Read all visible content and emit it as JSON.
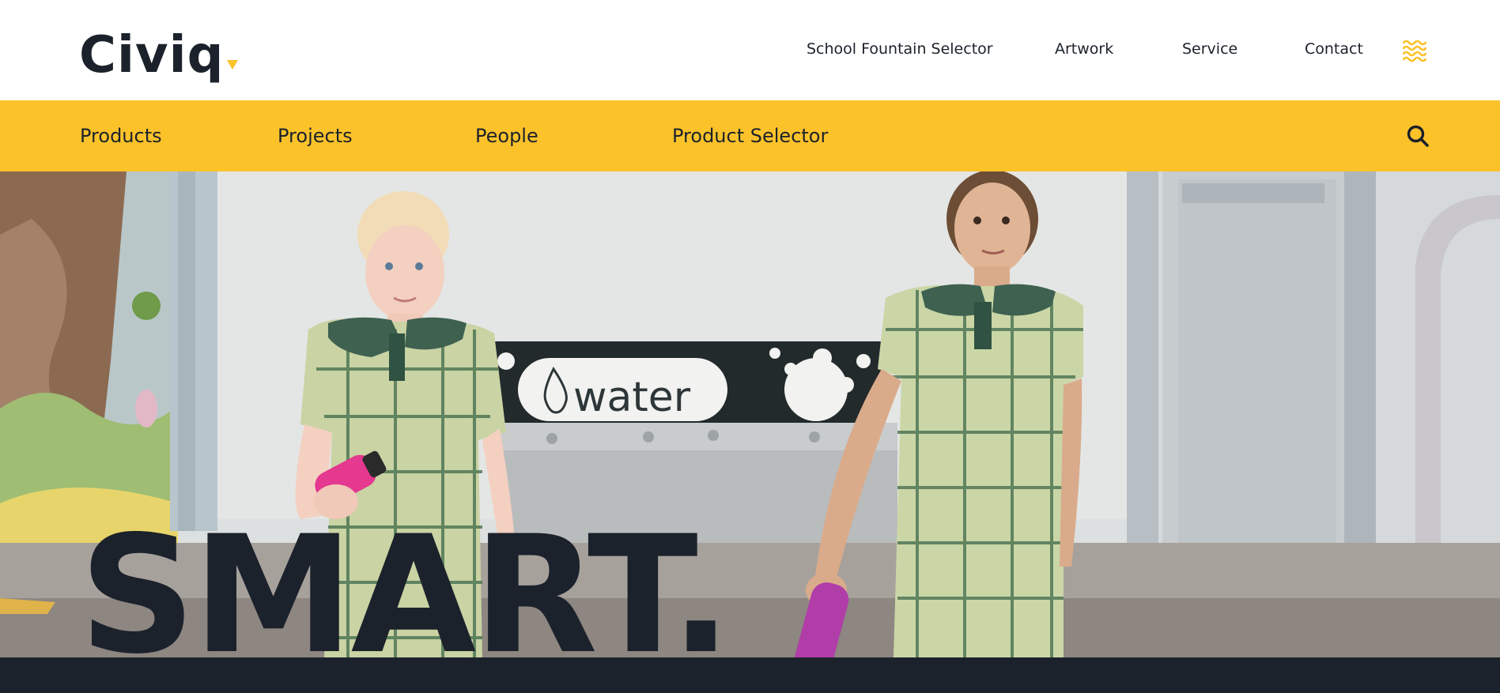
{
  "brand": {
    "name": "Civiq",
    "accent_color": "#fcc22a",
    "dark_color": "#1c222b"
  },
  "utility_nav": {
    "items": [
      {
        "label": "School Fountain Selector"
      },
      {
        "label": "Artwork"
      },
      {
        "label": "Service"
      },
      {
        "label": "Contact"
      }
    ],
    "menu_icon": "wavy-menu-icon"
  },
  "main_nav": {
    "items": [
      {
        "label": "Products"
      },
      {
        "label": "Projects"
      },
      {
        "label": "People"
      },
      {
        "label": "Product Selector"
      }
    ],
    "search_icon": "search-icon"
  },
  "hero": {
    "headline": "SMART.",
    "sign_text": "water"
  }
}
